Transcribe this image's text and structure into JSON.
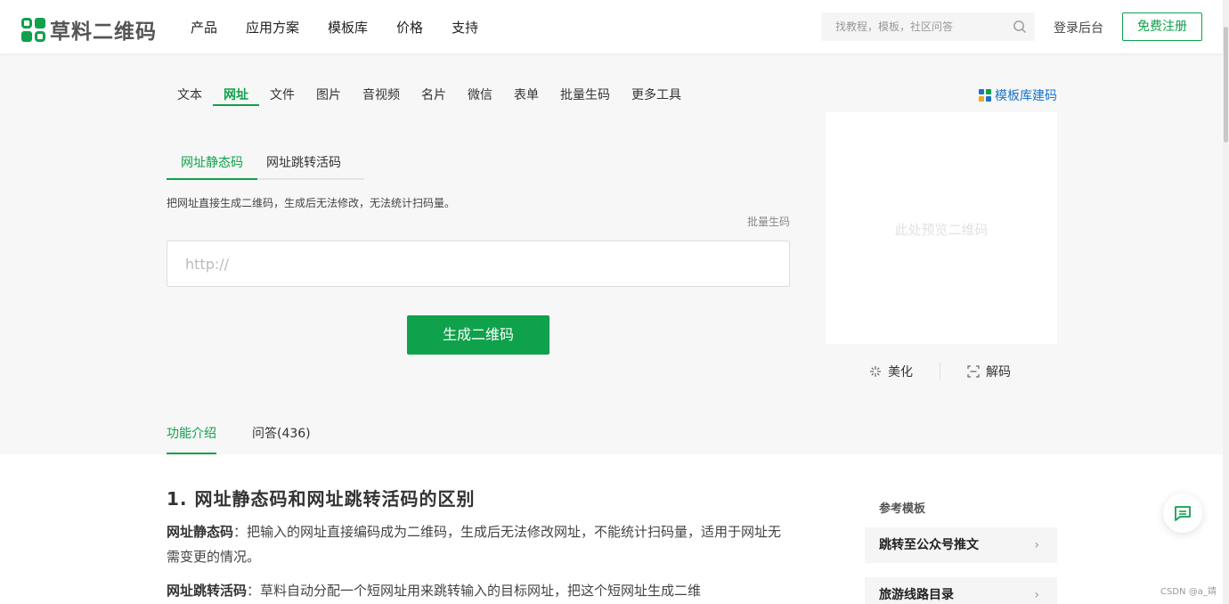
{
  "header": {
    "logo_text": "草料二维码",
    "nav": [
      "产品",
      "应用方案",
      "模板库",
      "价格",
      "支持"
    ],
    "search_placeholder": "找教程，模板，社区问答",
    "login": "登录后台",
    "register": "免费注册"
  },
  "type_tabs": [
    "文本",
    "网址",
    "文件",
    "图片",
    "音视频",
    "名片",
    "微信",
    "表单",
    "批量生码",
    "更多工具"
  ],
  "active_type_tab": "网址",
  "template_link": "模板库建码",
  "sub_tabs": [
    "网址静态码",
    "网址跳转活码"
  ],
  "description": "把网址直接生成二维码，生成后无法修改，无法统计扫码量。",
  "batch_link": "批量生码",
  "url_placeholder": "http://",
  "generate_button": "生成二维码",
  "preview_placeholder": "此处预览二维码",
  "tools": {
    "beautify": "美化",
    "decode": "解码"
  },
  "info_tabs": [
    "功能介绍",
    "问答(436)"
  ],
  "article": {
    "title": "1. 网址静态码和网址跳转活码的区别",
    "p1_label": "网址静态码",
    "p1_text": "：把输入的网址直接编码成为二维码，生成后无法修改网址，不能统计扫码量，适用于网址无需变更的情况。",
    "p2_label": "网址跳转活码",
    "p2_text": "：草料自动分配一个短网址用来跳转输入的目标网址，把这个短网址生成二维"
  },
  "reference": {
    "title": "参考模板",
    "items": [
      "跳转至公众号推文",
      "旅游线路目录"
    ]
  },
  "watermark": "CSDN @a_靖",
  "colors": {
    "brand_green": "#0fa14b",
    "link_blue": "#1a73c9"
  }
}
